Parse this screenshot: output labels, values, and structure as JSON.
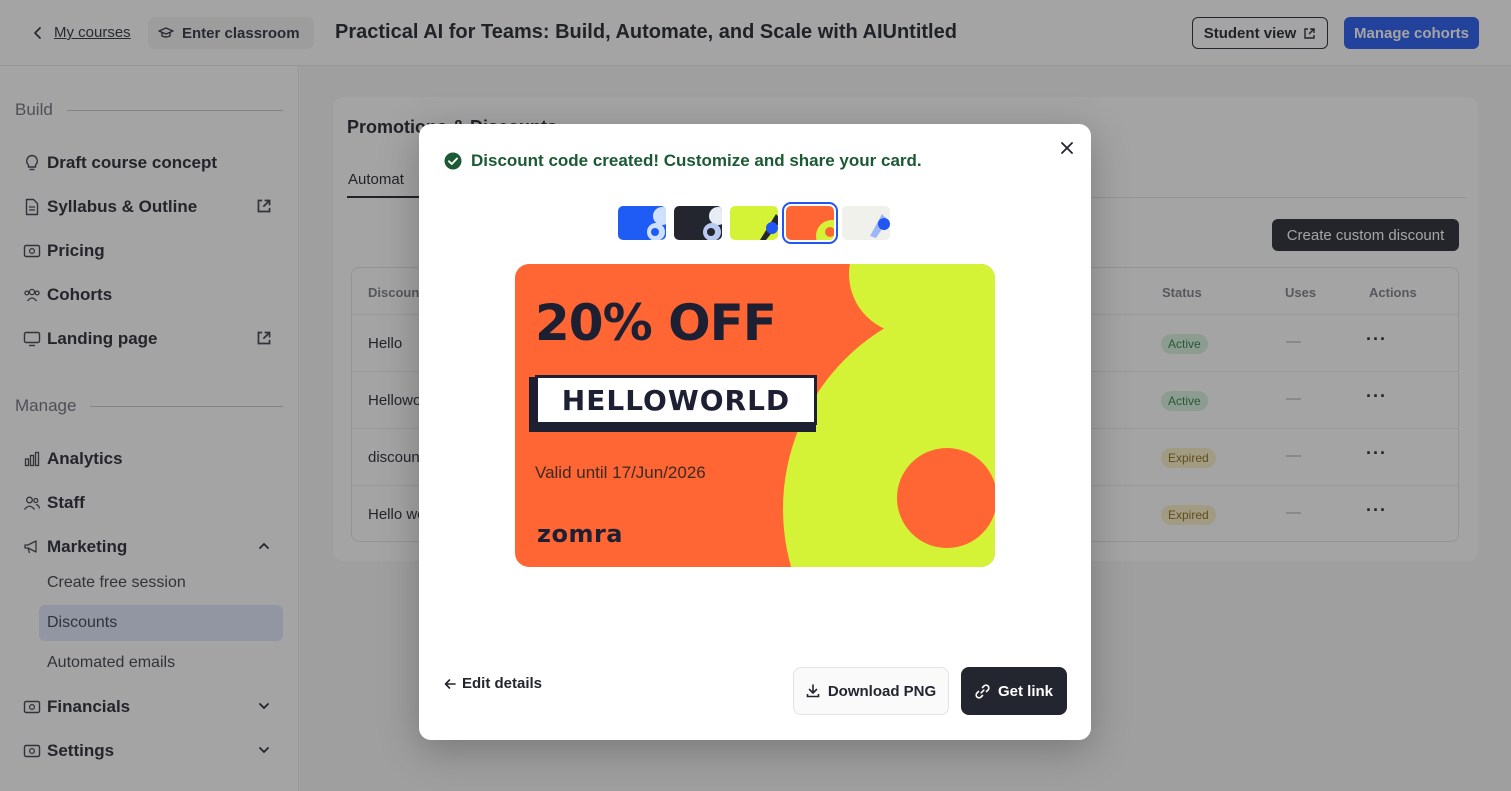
{
  "topbar": {
    "back_label": "My courses",
    "classroom_label": "Enter classroom",
    "course_title": "Practical AI for Teams: Build, Automate, and Scale with AIUntitled",
    "student_view_label": "Student view",
    "manage_cohorts_label": "Manage cohorts"
  },
  "sidebar": {
    "build_heading": "Build",
    "build_items": [
      {
        "label": "Draft course concept",
        "icon": "lightbulb-icon"
      },
      {
        "label": "Syllabus & Outline",
        "icon": "document-icon",
        "external": true
      },
      {
        "label": "Pricing",
        "icon": "money-icon"
      },
      {
        "label": "Cohorts",
        "icon": "people-icon"
      },
      {
        "label": "Landing page",
        "icon": "monitor-icon",
        "external": true
      }
    ],
    "manage_heading": "Manage",
    "manage_items": [
      {
        "label": "Analytics",
        "icon": "bar-chart-icon"
      },
      {
        "label": "Staff",
        "icon": "users-icon"
      },
      {
        "label": "Marketing",
        "icon": "megaphone-icon",
        "expanded": true
      }
    ],
    "marketing_sub": [
      "Create free session",
      "Discounts",
      "Automated emails"
    ],
    "active_sub": "Discounts",
    "bottom_items": [
      {
        "label": "Financials",
        "icon": "money-icon"
      },
      {
        "label": "Settings",
        "icon": "settings-icon"
      }
    ]
  },
  "main": {
    "panel_title": "Promotions & Discounts",
    "tab_label": "Automat",
    "create_custom_label": "Create custom discount",
    "columns": {
      "discount": "Discoun",
      "status": "Status",
      "uses": "Uses",
      "actions": "Actions"
    },
    "rows": [
      {
        "name": "Hello",
        "status": "Active",
        "uses": "—"
      },
      {
        "name": "Hellowo",
        "status": "Active",
        "uses": "—"
      },
      {
        "name": "discoun",
        "status": "Expired",
        "uses": "—"
      },
      {
        "name": "Hello wo",
        "status": "Expired",
        "uses": "—"
      }
    ],
    "row_actions": "···"
  },
  "modal": {
    "success_message": "Discount code created! Customize and share your card.",
    "swatches": [
      "blue",
      "dark",
      "lime",
      "orange",
      "cream"
    ],
    "selected_swatch": "orange",
    "card": {
      "headline": "20% OFF",
      "code": "HELLOWORLD",
      "valid_text": "Valid until 17/Jun/2026",
      "brand": "zomra",
      "colors": {
        "background": "#FF6633",
        "accent": "#D4F336",
        "ink": "#1D1F33"
      }
    },
    "edit_label": "Edit details",
    "download_label": "Download PNG",
    "get_link_label": "Get link"
  },
  "colors": {
    "primary": "#2156F0",
    "success": "#1C5A35",
    "dark": "#23252F"
  }
}
